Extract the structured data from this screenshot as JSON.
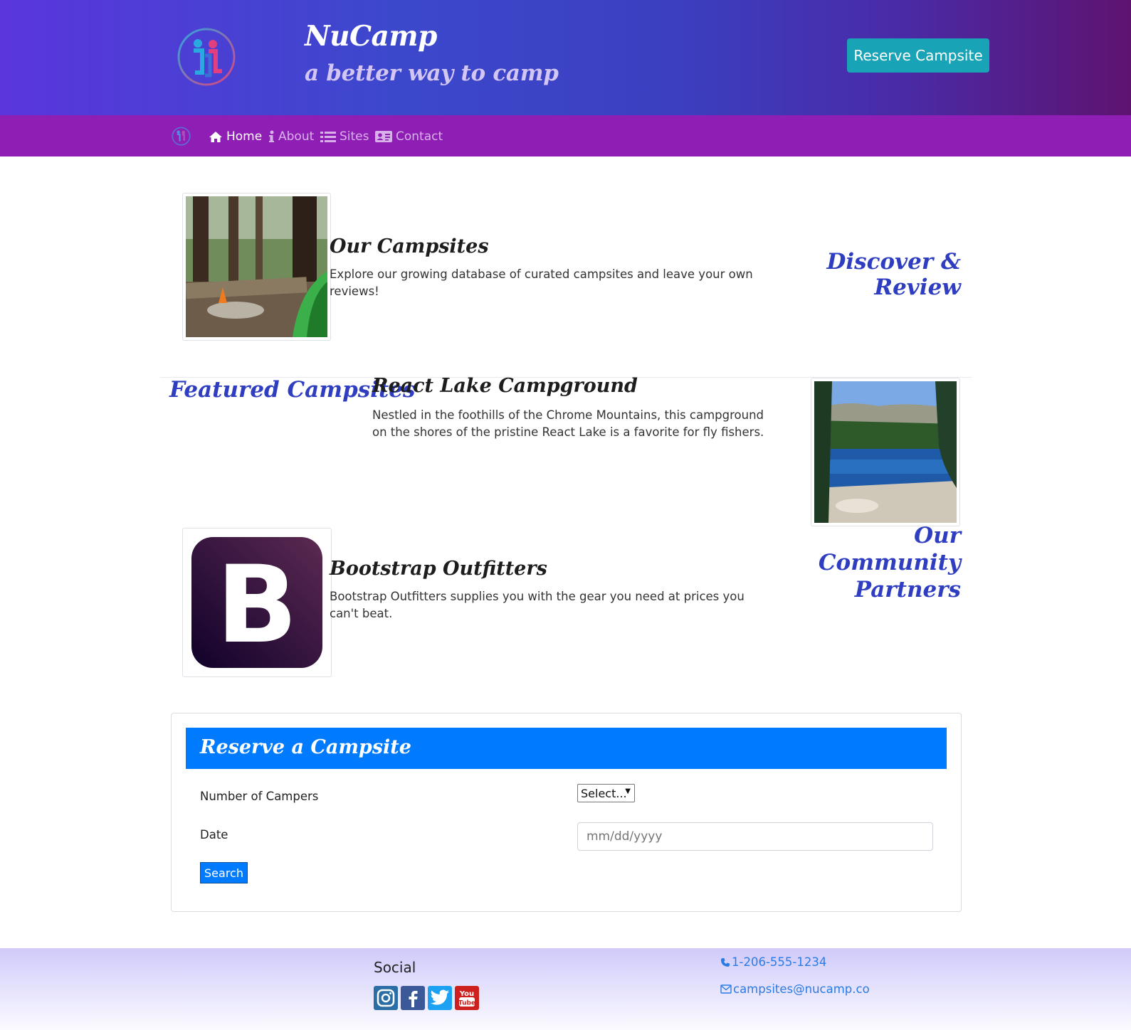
{
  "header": {
    "title": "NuCamp",
    "tagline": "a better way to camp",
    "reserve_button": "Reserve Campsite"
  },
  "nav": {
    "items": [
      {
        "label": "Home",
        "icon": "home-icon",
        "active": true
      },
      {
        "label": "About",
        "icon": "info-icon",
        "active": false
      },
      {
        "label": "Sites",
        "icon": "list-icon",
        "active": false
      },
      {
        "label": "Contact",
        "icon": "address-card-icon",
        "active": false
      }
    ]
  },
  "sections": {
    "campsites": {
      "title": "Our Campsites",
      "body": "Explore our growing database of curated campsites and leave your own reviews!",
      "heading": "Discover & Review"
    },
    "featured": {
      "heading": "Featured Campsites",
      "title": "React Lake Campground",
      "body": "Nestled in the foothills of the Chrome Mountains, this campground on the shores of the pristine React Lake is a favorite for fly fishers."
    },
    "partners": {
      "heading_line1": "Our Community",
      "heading_line2": "Partners",
      "title": "Bootstrap Outfitters",
      "body": "Bootstrap Outfitters supplies you with the gear you need at prices you can't beat.",
      "logo_letter": "B"
    }
  },
  "reserve_form": {
    "title": "Reserve a Campsite",
    "campers_label": "Number of Campers",
    "campers_value": "Select...",
    "date_label": "Date",
    "date_placeholder": "mm/dd/yyyy",
    "search_button": "Search"
  },
  "footer": {
    "social_title": "Social",
    "social_icons": [
      "instagram-icon",
      "facebook-icon",
      "twitter-icon",
      "youtube-icon"
    ],
    "youtube_text_1": "You",
    "youtube_text_2": "Tube",
    "phone": "1-206-555-1234",
    "email": "campsites@nucamp.co"
  },
  "colors": {
    "header_gradient_start": "#5a36dc",
    "header_gradient_end": "#5e1370",
    "navbar": "#8f1fb4",
    "accent_teal": "#19a3b6",
    "heading_blue": "#2f3ec0",
    "primary": "#007bff",
    "link": "#2b7be5"
  }
}
